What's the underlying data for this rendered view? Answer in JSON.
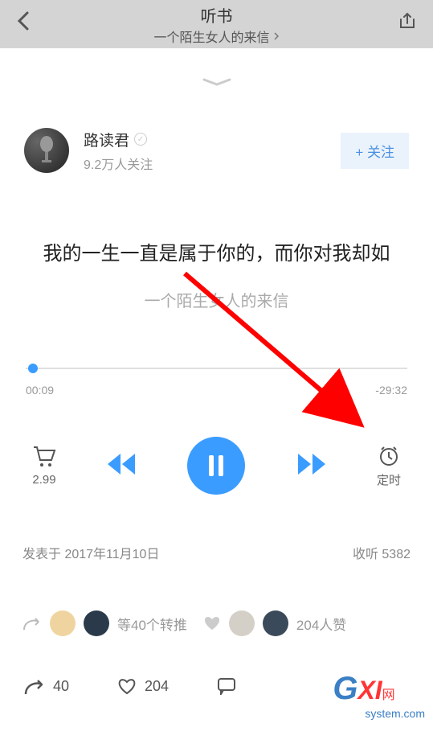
{
  "header": {
    "title": "听书",
    "subtitle": "一个陌生女人的来信"
  },
  "author": {
    "name": "路读君",
    "followers": "9.2万人关注",
    "follow_button": "+ 关注"
  },
  "track": {
    "title": "我的一生一直是属于你的，而你对我却如",
    "subtitle": "一个陌生女人的来信"
  },
  "progress": {
    "elapsed": "00:09",
    "remaining": "-29:32"
  },
  "controls": {
    "price": "2.99",
    "timer": "定时"
  },
  "meta": {
    "published_prefix": "发表于 ",
    "published_date": "2017年11月10日",
    "listen_label": "收听 ",
    "listen_count": "5382"
  },
  "social": {
    "reposts_text": "等40个转推",
    "likes_text": "204人赞"
  },
  "bottom": {
    "share_count": "40",
    "like_count": "204"
  },
  "watermark": {
    "g": "G",
    "xi": "XI",
    "net": "网",
    "sys": "system.com"
  }
}
